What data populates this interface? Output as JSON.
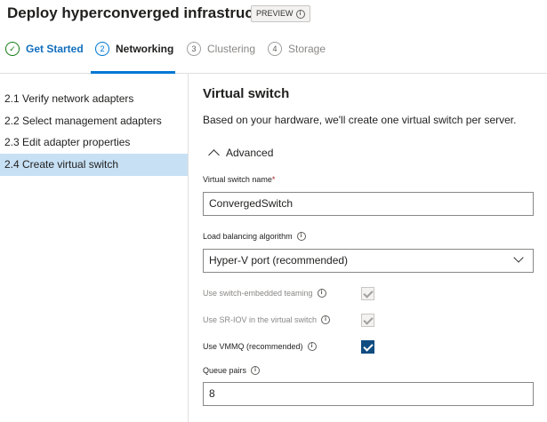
{
  "header": {
    "title": "Deploy hyperconverged infrastructure",
    "badge": "PREVIEW",
    "badge_icon": "info-icon"
  },
  "stepper": {
    "steps": [
      {
        "number": "✓",
        "label": "Get Started",
        "state": "complete"
      },
      {
        "number": "2",
        "label": "Networking",
        "state": "active"
      },
      {
        "number": "3",
        "label": "Clustering",
        "state": "pending"
      },
      {
        "number": "4",
        "label": "Storage",
        "state": "pending"
      }
    ]
  },
  "sidebar": {
    "items": [
      {
        "label": "2.1  Verify network adapters"
      },
      {
        "label": "2.2  Select management adapters"
      },
      {
        "label": "2.3  Edit adapter properties"
      },
      {
        "label": "2.4  Create virtual switch",
        "selected": true
      }
    ]
  },
  "main": {
    "title": "Virtual switch",
    "description": "Based on your hardware, we'll create one virtual switch per server.",
    "advanced_label": "Advanced",
    "switch_name": {
      "label": "Virtual switch name",
      "required_mark": "*",
      "value": "ConvergedSwitch"
    },
    "load_balancing": {
      "label": "Load balancing algorithm",
      "value": "Hyper-V port (recommended)"
    },
    "options": [
      {
        "label": "Use switch-embedded teaming",
        "checked": true,
        "disabled": true
      },
      {
        "label": "Use SR-IOV in the virtual switch",
        "checked": true,
        "disabled": true
      },
      {
        "label": "Use VMMQ (recommended)",
        "checked": true,
        "disabled": false
      }
    ],
    "queue_pairs": {
      "label": "Queue pairs",
      "value": "8"
    }
  },
  "colors": {
    "accent": "#0078d4",
    "selected_nav": "#c7e0f4",
    "complete_step": "#107c10",
    "checkbox_checked": "#0f4c81",
    "required": "#a4262c"
  }
}
